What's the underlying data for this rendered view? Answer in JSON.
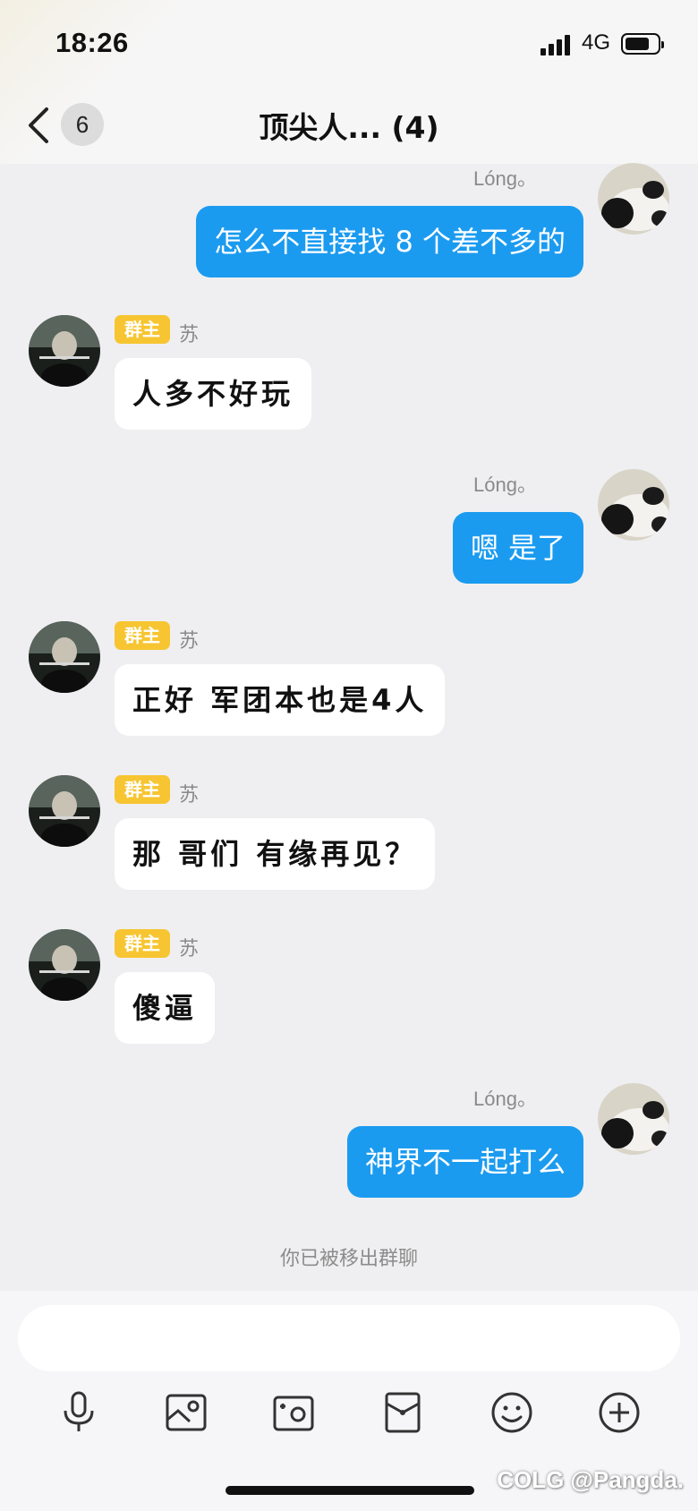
{
  "status_bar": {
    "time": "18:26",
    "network": "4G"
  },
  "header": {
    "unread_count": "6",
    "title": "顶尖人... (4)"
  },
  "messages": [
    {
      "side": "out",
      "sender": "Lóng。",
      "text": "怎么不直接找 8 个差不多的"
    },
    {
      "side": "in",
      "badge": "群主",
      "sender": "苏",
      "text": "人多不好玩"
    },
    {
      "side": "out",
      "sender": "Lóng。",
      "text": "嗯 是了"
    },
    {
      "side": "in",
      "badge": "群主",
      "sender": "苏",
      "text": "正好 军团本也是4人"
    },
    {
      "side": "in",
      "badge": "群主",
      "sender": "苏",
      "text": "那 哥们  有缘再见？"
    },
    {
      "side": "in",
      "badge": "群主",
      "sender": "苏",
      "text": "傻逼"
    },
    {
      "side": "out",
      "sender": "Lóng。",
      "text": "神界不一起打么"
    }
  ],
  "system_note": "你已被移出群聊",
  "input": {
    "placeholder": ""
  },
  "toolbar": [
    "microphone-icon",
    "image-icon",
    "camera-icon",
    "red-packet-icon",
    "emoji-icon",
    "plus-icon"
  ],
  "watermark": "COLG @Pangda.",
  "colors": {
    "outgoing_bubble": "#1b9bf0",
    "incoming_bubble": "#ffffff",
    "owner_badge": "#f7c531",
    "background": "#efeff1"
  }
}
